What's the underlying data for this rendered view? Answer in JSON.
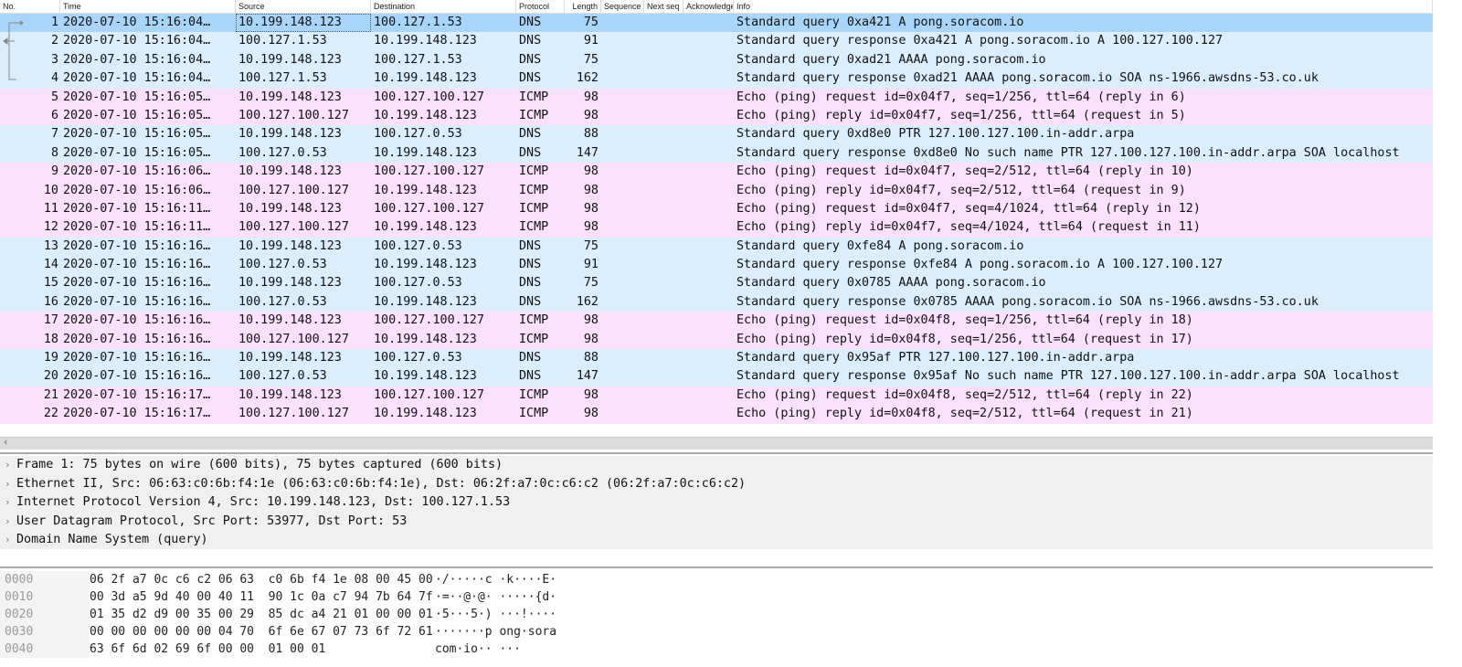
{
  "columns": [
    "No.",
    "Time",
    "Source",
    "Destination",
    "Protocol",
    "Length",
    "Sequence",
    "Next seq",
    "Acknowledge",
    "Info"
  ],
  "colors": {
    "selected": "#a9d5fb",
    "dns": "#daeefe",
    "icmp": "#fbe1fd"
  },
  "packets": [
    {
      "no": "1",
      "time": "2020-07-10 15:16:04…",
      "src": "10.199.148.123",
      "dst": "100.127.1.53",
      "proto": "DNS",
      "len": "75",
      "info": "Standard query 0xa421 A pong.soracom.io",
      "selected": true
    },
    {
      "no": "2",
      "time": "2020-07-10 15:16:04…",
      "src": "100.127.1.53",
      "dst": "10.199.148.123",
      "proto": "DNS",
      "len": "91",
      "info": "Standard query response 0xa421 A pong.soracom.io A 100.127.100.127"
    },
    {
      "no": "3",
      "time": "2020-07-10 15:16:04…",
      "src": "10.199.148.123",
      "dst": "100.127.1.53",
      "proto": "DNS",
      "len": "75",
      "info": "Standard query 0xad21 AAAA pong.soracom.io"
    },
    {
      "no": "4",
      "time": "2020-07-10 15:16:04…",
      "src": "100.127.1.53",
      "dst": "10.199.148.123",
      "proto": "DNS",
      "len": "162",
      "info": "Standard query response 0xad21 AAAA pong.soracom.io SOA ns-1966.awsdns-53.co.uk"
    },
    {
      "no": "5",
      "time": "2020-07-10 15:16:05…",
      "src": "10.199.148.123",
      "dst": "100.127.100.127",
      "proto": "ICMP",
      "len": "98",
      "info": "Echo (ping) request  id=0x04f7, seq=1/256, ttl=64 (reply in 6)"
    },
    {
      "no": "6",
      "time": "2020-07-10 15:16:05…",
      "src": "100.127.100.127",
      "dst": "10.199.148.123",
      "proto": "ICMP",
      "len": "98",
      "info": "Echo (ping) reply    id=0x04f7, seq=1/256, ttl=64 (request in 5)"
    },
    {
      "no": "7",
      "time": "2020-07-10 15:16:05…",
      "src": "10.199.148.123",
      "dst": "100.127.0.53",
      "proto": "DNS",
      "len": "88",
      "info": "Standard query 0xd8e0 PTR 127.100.127.100.in-addr.arpa"
    },
    {
      "no": "8",
      "time": "2020-07-10 15:16:05…",
      "src": "100.127.0.53",
      "dst": "10.199.148.123",
      "proto": "DNS",
      "len": "147",
      "info": "Standard query response 0xd8e0 No such name PTR 127.100.127.100.in-addr.arpa SOA localhost"
    },
    {
      "no": "9",
      "time": "2020-07-10 15:16:06…",
      "src": "10.199.148.123",
      "dst": "100.127.100.127",
      "proto": "ICMP",
      "len": "98",
      "info": "Echo (ping) request  id=0x04f7, seq=2/512, ttl=64 (reply in 10)"
    },
    {
      "no": "10",
      "time": "2020-07-10 15:16:06…",
      "src": "100.127.100.127",
      "dst": "10.199.148.123",
      "proto": "ICMP",
      "len": "98",
      "info": "Echo (ping) reply    id=0x04f7, seq=2/512, ttl=64 (request in 9)"
    },
    {
      "no": "11",
      "time": "2020-07-10 15:16:11…",
      "src": "10.199.148.123",
      "dst": "100.127.100.127",
      "proto": "ICMP",
      "len": "98",
      "info": "Echo (ping) request  id=0x04f7, seq=4/1024, ttl=64 (reply in 12)"
    },
    {
      "no": "12",
      "time": "2020-07-10 15:16:11…",
      "src": "100.127.100.127",
      "dst": "10.199.148.123",
      "proto": "ICMP",
      "len": "98",
      "info": "Echo (ping) reply    id=0x04f7, seq=4/1024, ttl=64 (request in 11)"
    },
    {
      "no": "13",
      "time": "2020-07-10 15:16:16…",
      "src": "10.199.148.123",
      "dst": "100.127.0.53",
      "proto": "DNS",
      "len": "75",
      "info": "Standard query 0xfe84 A pong.soracom.io"
    },
    {
      "no": "14",
      "time": "2020-07-10 15:16:16…",
      "src": "100.127.0.53",
      "dst": "10.199.148.123",
      "proto": "DNS",
      "len": "91",
      "info": "Standard query response 0xfe84 A pong.soracom.io A 100.127.100.127"
    },
    {
      "no": "15",
      "time": "2020-07-10 15:16:16…",
      "src": "10.199.148.123",
      "dst": "100.127.0.53",
      "proto": "DNS",
      "len": "75",
      "info": "Standard query 0x0785 AAAA pong.soracom.io"
    },
    {
      "no": "16",
      "time": "2020-07-10 15:16:16…",
      "src": "100.127.0.53",
      "dst": "10.199.148.123",
      "proto": "DNS",
      "len": "162",
      "info": "Standard query response 0x0785 AAAA pong.soracom.io SOA ns-1966.awsdns-53.co.uk"
    },
    {
      "no": "17",
      "time": "2020-07-10 15:16:16…",
      "src": "10.199.148.123",
      "dst": "100.127.100.127",
      "proto": "ICMP",
      "len": "98",
      "info": "Echo (ping) request  id=0x04f8, seq=1/256, ttl=64 (reply in 18)"
    },
    {
      "no": "18",
      "time": "2020-07-10 15:16:16…",
      "src": "100.127.100.127",
      "dst": "10.199.148.123",
      "proto": "ICMP",
      "len": "98",
      "info": "Echo (ping) reply    id=0x04f8, seq=1/256, ttl=64 (request in 17)"
    },
    {
      "no": "19",
      "time": "2020-07-10 15:16:16…",
      "src": "10.199.148.123",
      "dst": "100.127.0.53",
      "proto": "DNS",
      "len": "88",
      "info": "Standard query 0x95af PTR 127.100.127.100.in-addr.arpa"
    },
    {
      "no": "20",
      "time": "2020-07-10 15:16:16…",
      "src": "100.127.0.53",
      "dst": "10.199.148.123",
      "proto": "DNS",
      "len": "147",
      "info": "Standard query response 0x95af No such name PTR 127.100.127.100.in-addr.arpa SOA localhost"
    },
    {
      "no": "21",
      "time": "2020-07-10 15:16:17…",
      "src": "10.199.148.123",
      "dst": "100.127.100.127",
      "proto": "ICMP",
      "len": "98",
      "info": "Echo (ping) request  id=0x04f8, seq=2/512, ttl=64 (reply in 22)"
    },
    {
      "no": "22",
      "time": "2020-07-10 15:16:17…",
      "src": "100.127.100.127",
      "dst": "10.199.148.123",
      "proto": "ICMP",
      "len": "98",
      "info": "Echo (ping) reply    id=0x04f8, seq=2/512, ttl=64 (request in 21)"
    }
  ],
  "details": [
    "Frame 1: 75 bytes on wire (600 bits), 75 bytes captured (600 bits)",
    "Ethernet II, Src: 06:63:c0:6b:f4:1e (06:63:c0:6b:f4:1e), Dst: 06:2f:a7:0c:c6:c2 (06:2f:a7:0c:c6:c2)",
    "Internet Protocol Version 4, Src: 10.199.148.123, Dst: 100.127.1.53",
    "User Datagram Protocol, Src Port: 53977, Dst Port: 53",
    "Domain Name System (query)"
  ],
  "hex": [
    {
      "offset": "0000",
      "bytes": "06 2f a7 0c c6 c2 06 63  c0 6b f4 1e 08 00 45 00",
      "ascii": "·/·····c ·k····E·"
    },
    {
      "offset": "0010",
      "bytes": "00 3d a5 9d 40 00 40 11  90 1c 0a c7 94 7b 64 7f",
      "ascii": "·=··@·@· ·····{d·"
    },
    {
      "offset": "0020",
      "bytes": "01 35 d2 d9 00 35 00 29  85 dc a4 21 01 00 00 01",
      "ascii": "·5···5·) ···!····"
    },
    {
      "offset": "0030",
      "bytes": "00 00 00 00 00 00 04 70  6f 6e 67 07 73 6f 72 61",
      "ascii": "·······p ong·sora"
    },
    {
      "offset": "0040",
      "bytes": "63 6f 6d 02 69 6f 00 00  01 00 01",
      "ascii": "com·io·· ···"
    }
  ],
  "scroll_left_icon": "‹",
  "chevron_icon": "›"
}
